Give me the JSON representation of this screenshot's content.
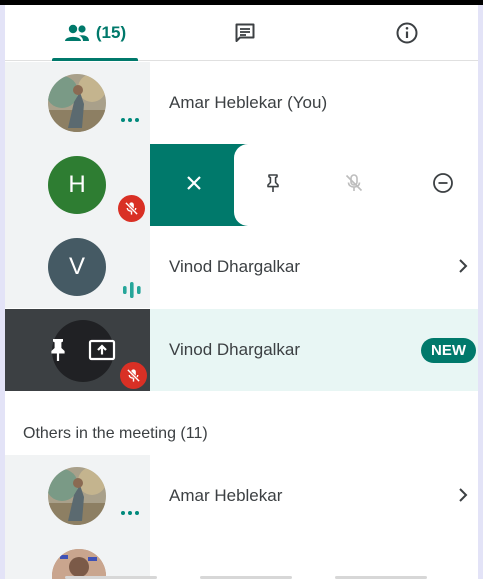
{
  "tabs": {
    "people_count": "(15)",
    "people_icon": "people-icon",
    "chat_icon": "chat-icon",
    "info_icon": "info-icon",
    "accent": "#00796b"
  },
  "participants": [
    {
      "name": "Amar Heblekar (You)",
      "avatar": "photo",
      "status": "more-dots-icon"
    },
    {
      "name": "",
      "initial": "H",
      "avatar_color": "#2e7d32",
      "status": "mic-off-icon",
      "actions": [
        "close-icon",
        "pin-icon",
        "mic-off-icon",
        "remove-icon"
      ]
    },
    {
      "name": "Vinod Dhargalkar",
      "initial": "V",
      "avatar_color": "#455a64",
      "status": "audio-level-icon"
    },
    {
      "name": "Vinod Dhargalkar",
      "badge": "NEW",
      "status": "mic-off-icon",
      "tile_icons": [
        "pin-icon",
        "present-screen-icon"
      ]
    }
  ],
  "others": {
    "header": "Others in the meeting (11)",
    "items": [
      {
        "name": "Amar Heblekar",
        "avatar": "photo",
        "status": "more-dots-icon"
      }
    ]
  },
  "colors": {
    "teal": "#00796b",
    "mute_red": "#d93025",
    "new_row_bg": "#e8f6f4"
  }
}
